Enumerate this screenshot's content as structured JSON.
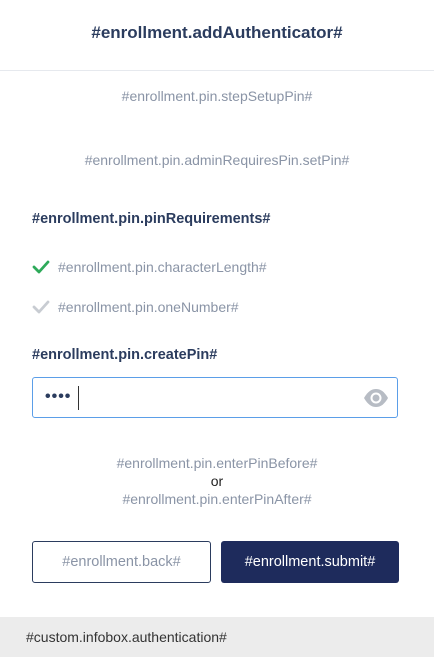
{
  "header": {
    "title": "#enrollment.addAuthenticator#"
  },
  "step": {
    "setup_text": "#enrollment.pin.stepSetupPin#"
  },
  "admin": {
    "requires_text": "#enrollment.pin.adminRequiresPin.setPin#"
  },
  "requirements": {
    "title": "#enrollment.pin.pinRequirements#",
    "items": [
      {
        "label": "#enrollment.pin.characterLength#",
        "met": true,
        "icon": "check-icon",
        "color": "#2eaa5a"
      },
      {
        "label": "#enrollment.pin.oneNumber#",
        "met": false,
        "icon": "check-icon",
        "color": "#c8ccd2"
      }
    ]
  },
  "pin": {
    "label": "#enrollment.pin.createPin#",
    "value": "••••",
    "toggle_icon": "eye-icon",
    "border_color": "#5b9ee8"
  },
  "hint": {
    "before": "#enrollment.pin.enterPinBefore#",
    "or": "or",
    "after": "#enrollment.pin.enterPinAfter#"
  },
  "actions": {
    "back_label": "#enrollment.back#",
    "submit_label": "#enrollment.submit#",
    "submit_color": "#1e2b5c"
  },
  "infobox": {
    "text": "#custom.infobox.authentication#"
  }
}
